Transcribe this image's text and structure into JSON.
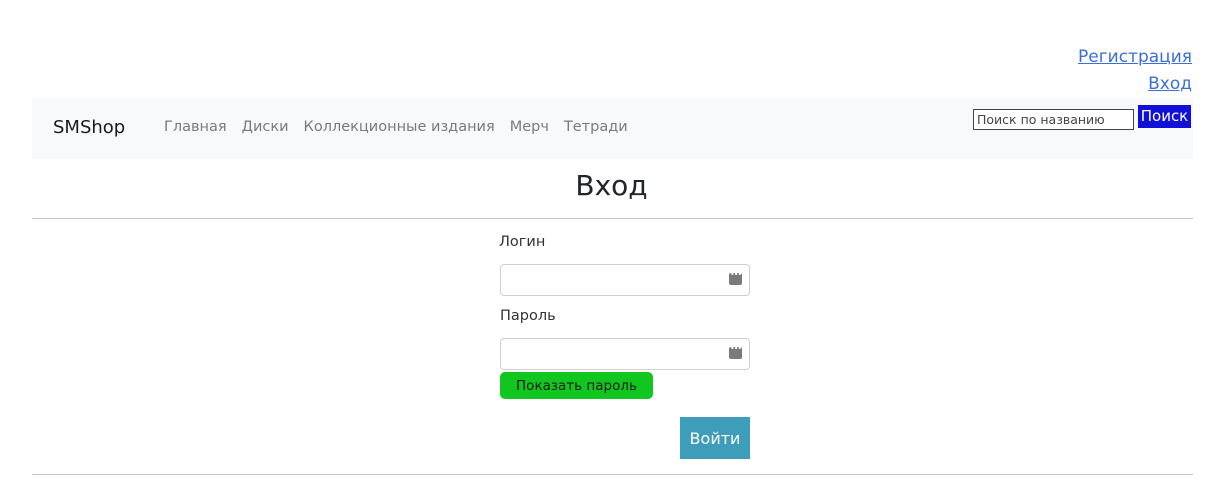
{
  "auth": {
    "register_label": "Регистрация",
    "login_label": "Вход"
  },
  "navbar": {
    "brand": "SMShop",
    "links": [
      "Главная",
      "Диски",
      "Коллекционные издания",
      "Мерч",
      "Тетради"
    ],
    "search": {
      "placeholder": "Поиск по названию",
      "value": "",
      "button_label": "Поиск"
    }
  },
  "main": {
    "title": "Вход",
    "login_label": "Логин",
    "login_value": "",
    "password_label": "Пароль",
    "password_value": "",
    "show_password_label": "Показать пароль",
    "submit_label": "Войти"
  },
  "icons": {
    "password_manager": "key-icon"
  },
  "colors": {
    "link": "#3a6fd8",
    "search_button": "#1010d8",
    "show_password_button": "#10c61f",
    "submit_button": "#3d9dbb",
    "navbar_bg": "#f8f9fa"
  }
}
